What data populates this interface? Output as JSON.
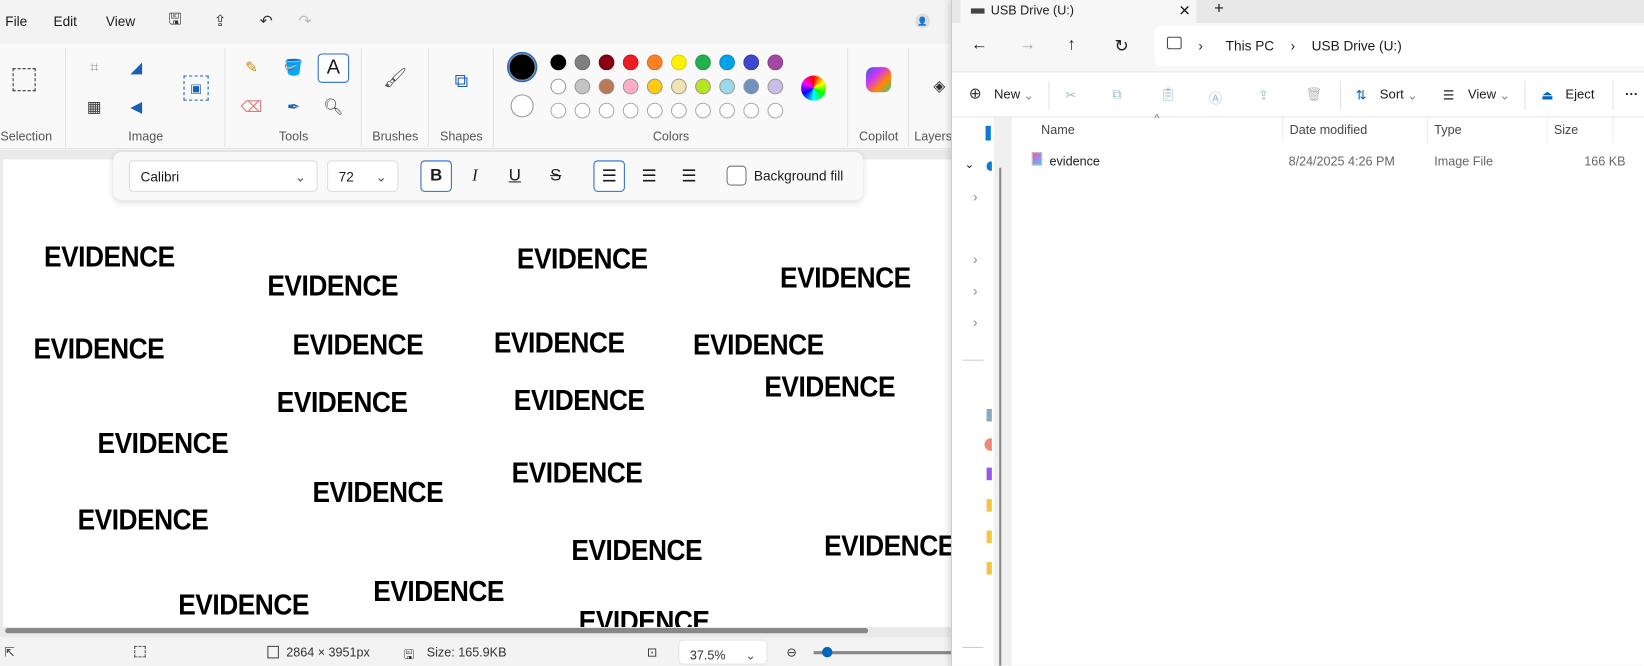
{
  "paint": {
    "menu": [
      "File",
      "Edit",
      "View"
    ],
    "groups": {
      "selection": "Selection",
      "image": "Image",
      "tools": "Tools",
      "brushes": "Brushes",
      "shapes": "Shapes",
      "colors": "Colors",
      "copilot": "Copilot",
      "layers": "Layers"
    },
    "palette": {
      "primary": "#000000",
      "secondary": "#ffffff",
      "row1": [
        "#000000",
        "#7f7f7f",
        "#880015",
        "#ed1c24",
        "#ff7f27",
        "#fff200",
        "#22b14c",
        "#00a2e8",
        "#3f48cc",
        "#a349a4"
      ],
      "row2": [
        "#ffffff",
        "#c3c3c3",
        "#b97a57",
        "#ffaec9",
        "#ffc90e",
        "#efe4b0",
        "#b5e61d",
        "#99d9ea",
        "#7092be",
        "#c8bfe7"
      ],
      "row3_empty_count": 10
    },
    "text_toolbar": {
      "font": "Calibri",
      "size": "72",
      "bold": true,
      "italic": false,
      "underline": false,
      "strikethrough": false,
      "align": "left",
      "background_fill_label": "Background fill",
      "background_fill": false
    },
    "canvas": {
      "words": [
        "EVIDENCE",
        "EVIDENCE",
        "EVIDENCE",
        "EVIDENCE",
        "EVIDENCE",
        "EVIDENCE",
        "EVIDENCE",
        "EVIDENCE",
        "EVIDENCE",
        "EVIDENCE",
        "EVIDENCE",
        "EVIDENCE",
        "EVIDENCE",
        "EVIDENCE",
        "EVIDENCE",
        "EVIDENCE",
        "EVIDENCE",
        "EVIDENCE",
        "EVIDENCE",
        "EVIDENCE"
      ]
    },
    "status": {
      "dimensions": "2864 × 3951px",
      "size": "Size: 165.9KB",
      "zoom": "37.5%",
      "zoom_level_percent": 37.5
    }
  },
  "explorer": {
    "tab_title": "USB Drive (U:)",
    "breadcrumb": [
      "This PC",
      "USB Drive (U:)"
    ],
    "commands": {
      "new": "New",
      "sort": "Sort",
      "view": "View",
      "eject": "Eject"
    },
    "columns": [
      "Name",
      "Date modified",
      "Type",
      "Size"
    ],
    "files": [
      {
        "name": "evidence",
        "date": "8/24/2025 4:26 PM",
        "type": "Image File",
        "size": "166 KB"
      }
    ],
    "accent": "#0067c0"
  }
}
